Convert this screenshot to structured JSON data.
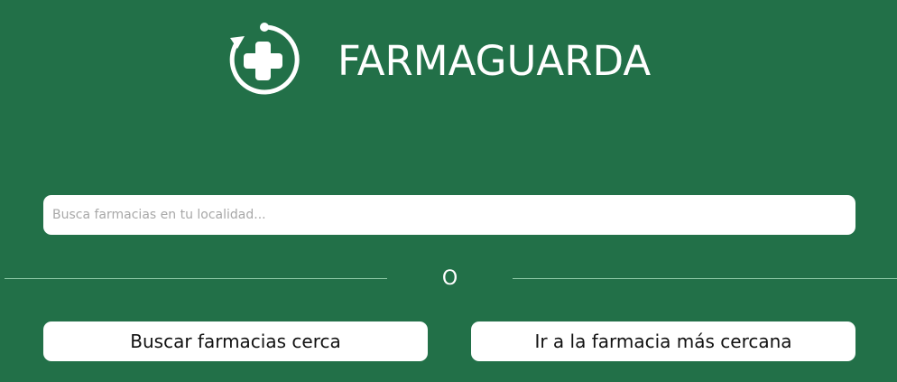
{
  "header": {
    "logo_icon": "pharmacy-cross-refresh-icon",
    "title": "FARMAGUARDA"
  },
  "search": {
    "placeholder": "Busca farmacias en tu localidad...",
    "value": ""
  },
  "divider": {
    "label": "O"
  },
  "actions": {
    "nearby_label": "Buscar farmacias cerca",
    "nearest_label": "Ir a la farmacia más cercana"
  },
  "colors": {
    "background": "#227048",
    "divider_line": "#8fcba7",
    "button_bg": "#ffffff",
    "text_light": "#ffffff",
    "text_dark": "#111111",
    "placeholder": "#a8a8a8"
  }
}
